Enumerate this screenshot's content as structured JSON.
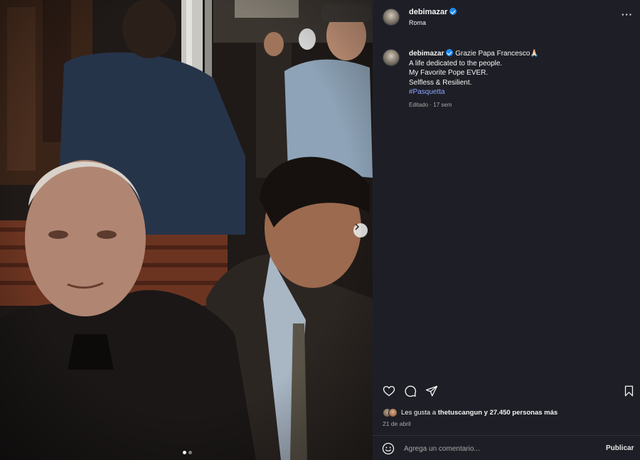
{
  "post": {
    "media": {
      "description_icon": "photo",
      "next_icon": "chevron-right-icon",
      "carousel_dots": 2,
      "carousel_active_index": 0
    },
    "header": {
      "username": "debimazar",
      "location": "Roma",
      "more_icon": "more-icon",
      "more_label": "···"
    },
    "caption": {
      "username": "debimazar",
      "first_line": "Grazie Papa Francesco",
      "emoji": "🙏🏻",
      "lines": [
        "A life dedicated to the people.",
        "My Favorite Pope EVER.",
        "Selfless & Resilient."
      ],
      "hashtag": "#Pasquetta",
      "meta": "Editado · 17 sem"
    },
    "actions": {
      "like_icon": "heart-icon",
      "comment_icon": "comment-icon",
      "share_icon": "share-icon",
      "save_icon": "bookmark-icon"
    },
    "likes": {
      "prefix": "Les gusta a ",
      "user": "thetuscangun",
      "suffix": " y 27.450 personas más"
    },
    "date": "21 de abril",
    "comment": {
      "placeholder": "Agrega un comentario...",
      "publish_label": "Publicar",
      "emoji_icon": "smiley-icon"
    },
    "colors": {
      "panel_bg": "#1e1f26",
      "verified": "#1d8cf0",
      "hashtag": "#8ea4ff",
      "muted": "#a8a8a8"
    }
  }
}
